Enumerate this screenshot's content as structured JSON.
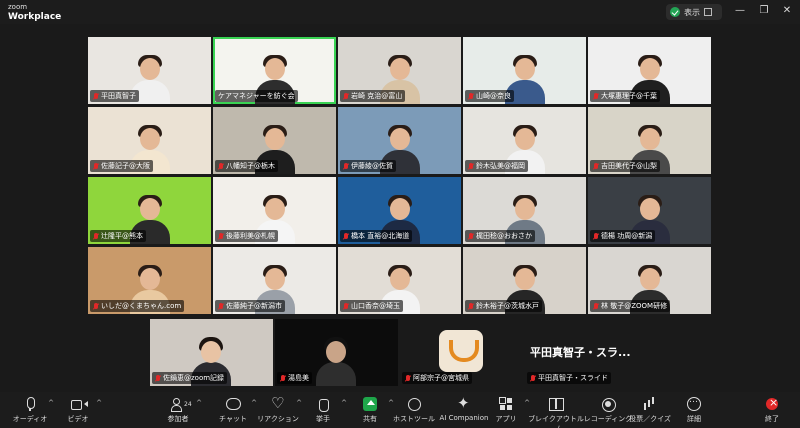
{
  "titlebar": {
    "logo_line1": "zoom",
    "logo_line2": "Workplace",
    "view_label": "表示",
    "minimize": "—",
    "restore": "❐",
    "close": "✕"
  },
  "participants": [
    {
      "name": "平田真智子",
      "muted": true
    },
    {
      "name": "ケアマネジャーを紡ぐ会",
      "muted": false
    },
    {
      "name": "岩崎 克治@富山",
      "muted": true
    },
    {
      "name": "山崎@奈良",
      "muted": true
    },
    {
      "name": "大塚惠理子@千葉",
      "muted": true
    },
    {
      "name": "佐藤記子@大阪",
      "muted": true
    },
    {
      "name": "八幡知子@栃木",
      "muted": true
    },
    {
      "name": "伊藤綾@佐賀",
      "muted": true
    },
    {
      "name": "鈴木弘美@福岡",
      "muted": true
    },
    {
      "name": "吉田美代子@山梨",
      "muted": true
    },
    {
      "name": "辻隆平@熊本",
      "muted": true
    },
    {
      "name": "後藤利美@札幌",
      "muted": true
    },
    {
      "name": "橋本 直裕@北海道",
      "muted": true
    },
    {
      "name": "梶田稔@おおさか",
      "muted": true
    },
    {
      "name": "德楊 功周@新潟",
      "muted": true
    },
    {
      "name": "いしだ@くまちゃん.com",
      "muted": true
    },
    {
      "name": "佐藤純子@新潟市",
      "muted": true
    },
    {
      "name": "山口香奈@埼玉",
      "muted": true
    },
    {
      "name": "鈴木裕子@茨城水戸",
      "muted": true
    },
    {
      "name": "林 敬子@ZOOM研修",
      "muted": true
    }
  ],
  "bottom_row": [
    {
      "name": "佐鍋恵@zoom記録",
      "muted": true
    },
    {
      "name": "湯島美",
      "muted": true
    },
    {
      "name": "阿部宗子@宮城県",
      "muted": true
    },
    {
      "name": "平田真智子・スライド",
      "muted": true
    }
  ],
  "screenshare_title": "平田真智子・スラ...",
  "toolbar": {
    "audio": "オーディオ",
    "video": "ビデオ",
    "participants": "参加者",
    "participants_count": "24",
    "chat": "チャット",
    "reactions": "リアクション",
    "raise_hand": "挙手",
    "share": "共有",
    "host_tools": "ホストツール",
    "ai_companion": "AI Companion",
    "apps": "アプリ",
    "breakout_rooms": "ブレイクアウトルーム",
    "recording": "レコーディング",
    "polls": "投票／クイズ",
    "more": "詳細",
    "end": "終了"
  }
}
